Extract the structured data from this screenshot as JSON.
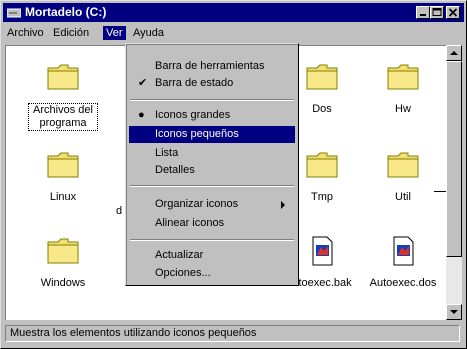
{
  "window": {
    "title": "Mortadelo (C:)"
  },
  "menubar": {
    "items": [
      "Archivo",
      "Edición",
      "Ver",
      "Ayuda"
    ]
  },
  "view_menu": {
    "items": [
      {
        "label": "Barra de herramientas",
        "mark": ""
      },
      {
        "label": "Barra de estado",
        "mark": "✔"
      },
      {
        "label": "Iconos grandes",
        "mark": "●"
      },
      {
        "label": "Iconos pequeños",
        "mark": "",
        "highlighted": true
      },
      {
        "label": "Lista",
        "mark": ""
      },
      {
        "label": "Detalles",
        "mark": ""
      },
      {
        "label": "Organizar iconos",
        "mark": "",
        "submenu": true
      },
      {
        "label": "Alinear iconos",
        "mark": ""
      },
      {
        "label": "Actualizar",
        "mark": ""
      },
      {
        "label": "Opciones...",
        "mark": ""
      }
    ]
  },
  "folder_icons": [
    {
      "label": "Archivos del programa",
      "kind": "folder-icon"
    },
    {
      "label": "Dos",
      "kind": "folder-icon"
    },
    {
      "label": "Hw",
      "kind": "folder-icon"
    },
    {
      "label": "Linux",
      "kind": "folder-icon"
    },
    {
      "label": "Tmp",
      "kind": "folder-icon"
    },
    {
      "label": "Util",
      "kind": "folder-icon"
    },
    {
      "label": "Windows",
      "kind": "folder-icon"
    },
    {
      "label": "utoexec.bak",
      "kind": "batch-file-icon"
    },
    {
      "label": "Autoexec.dos",
      "kind": "batch-file-icon"
    }
  ],
  "partial_label": "d",
  "statusbar": {
    "text": "Muestra los elementos utilizando iconos pequeños"
  },
  "colors": {
    "titlebar": "#000080",
    "highlight": "#000080",
    "face": "#c0c0c0",
    "folder": "#f4e070"
  }
}
